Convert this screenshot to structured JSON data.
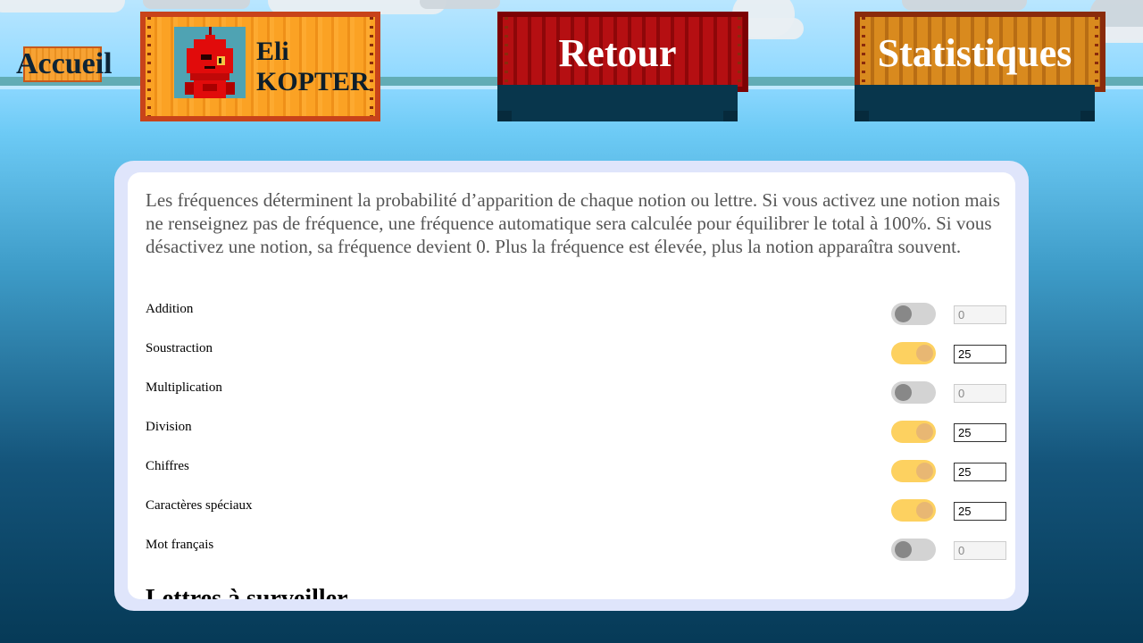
{
  "header": {
    "home_label": "Accueil",
    "profile": {
      "first_name": "Eli",
      "last_name": "KOPTER"
    },
    "back_label": "Retour",
    "stats_label": "Statistiques"
  },
  "settings": {
    "intro": "Les fréquences déterminent la probabilité d’apparition de chaque notion ou lettre. Si vous activez une notion mais ne renseignez pas de fréquence, une fréquence automatique sera calculée pour équilibrer le total à 100%. Si vous désactivez une notion, sa fréquence devient 0. Plus la fréquence est élevée, plus la notion apparaîtra souvent.",
    "notions": [
      {
        "label": "Addition",
        "enabled": false,
        "frequency": "0"
      },
      {
        "label": "Soustraction",
        "enabled": true,
        "frequency": "25"
      },
      {
        "label": "Multiplication",
        "enabled": false,
        "frequency": "0"
      },
      {
        "label": "Division",
        "enabled": true,
        "frequency": "25"
      },
      {
        "label": "Chiffres",
        "enabled": true,
        "frequency": "25"
      },
      {
        "label": "Caractères spéciaux",
        "enabled": true,
        "frequency": "25"
      },
      {
        "label": "Mot français",
        "enabled": false,
        "frequency": "0"
      }
    ],
    "next_section_title": "Lettres à surveiller"
  },
  "colors": {
    "toggle_on": "#fdd160",
    "toggle_off": "#d3d3d3",
    "panel_border": "#dfe5fb",
    "container_orange": "#fba224",
    "container_red": "#b50f12"
  }
}
